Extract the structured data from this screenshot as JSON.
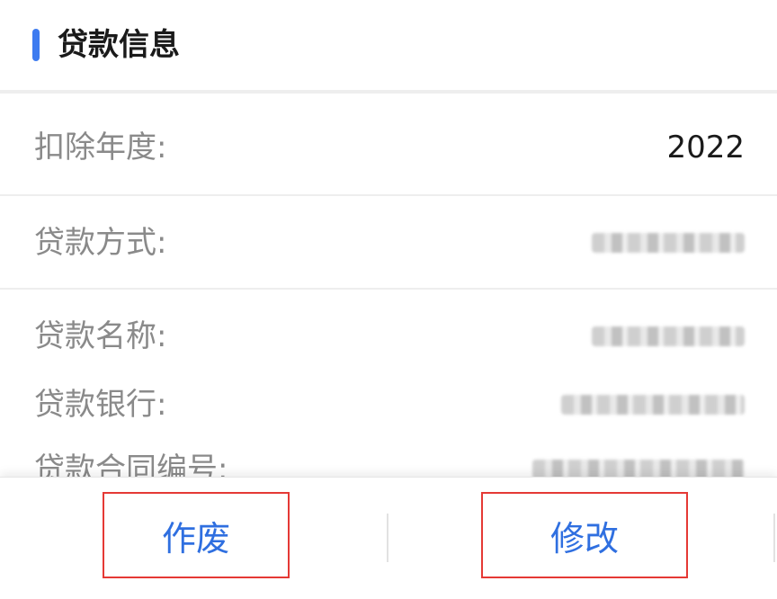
{
  "section": {
    "title": "贷款信息"
  },
  "fields": [
    {
      "label": "扣除年度:",
      "value": "2022"
    },
    {
      "label": "贷款方式:",
      "value": ""
    },
    {
      "label": "贷款名称:",
      "value": ""
    },
    {
      "label": "贷款银行:",
      "value": ""
    },
    {
      "label": "贷款合同编号:",
      "value": ""
    }
  ],
  "actions": {
    "void_label": "作废",
    "modify_label": "修改"
  },
  "colors": {
    "accent": "#3d7bf0",
    "action_text": "#2f6fe0",
    "highlight_border": "#e53935"
  }
}
